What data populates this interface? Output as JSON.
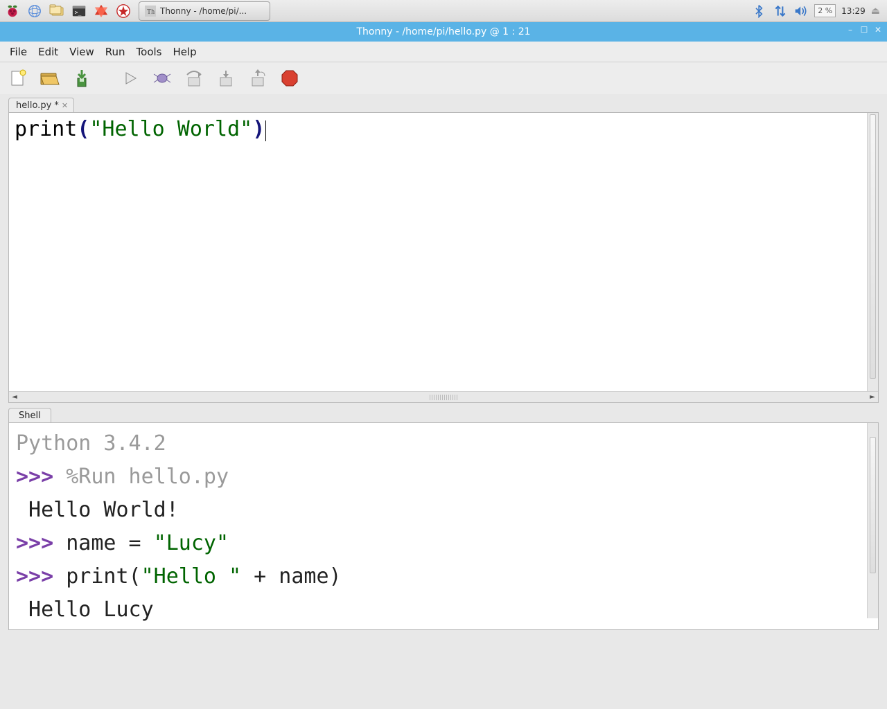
{
  "os": {
    "taskbar_app_label": "Thonny  -  /home/pi/...",
    "cpu_percent": "2 %",
    "clock": "13:29"
  },
  "window": {
    "title": "Thonny  -  /home/pi/hello.py  @  1 : 21"
  },
  "menubar": {
    "file": "File",
    "edit": "Edit",
    "view": "View",
    "run": "Run",
    "tools": "Tools",
    "help": "Help"
  },
  "tabs": {
    "file_tab_label": "hello.py *",
    "shell_tab_label": "Shell"
  },
  "editor": {
    "tok_print": "print",
    "tok_lparen": "(",
    "tok_string": "\"Hello World\"",
    "tok_rparen": ")"
  },
  "shell": {
    "banner": "Python 3.4.2",
    "prompt": ">>> ",
    "run_cmd": "%Run hello.py",
    "out1": " Hello World!",
    "line2_pre": "name = ",
    "line2_str": "\"Lucy\"",
    "line3_pre": "print(",
    "line3_str": "\"Hello \"",
    "line3_post": " + name)",
    "out2": " Hello Lucy"
  }
}
